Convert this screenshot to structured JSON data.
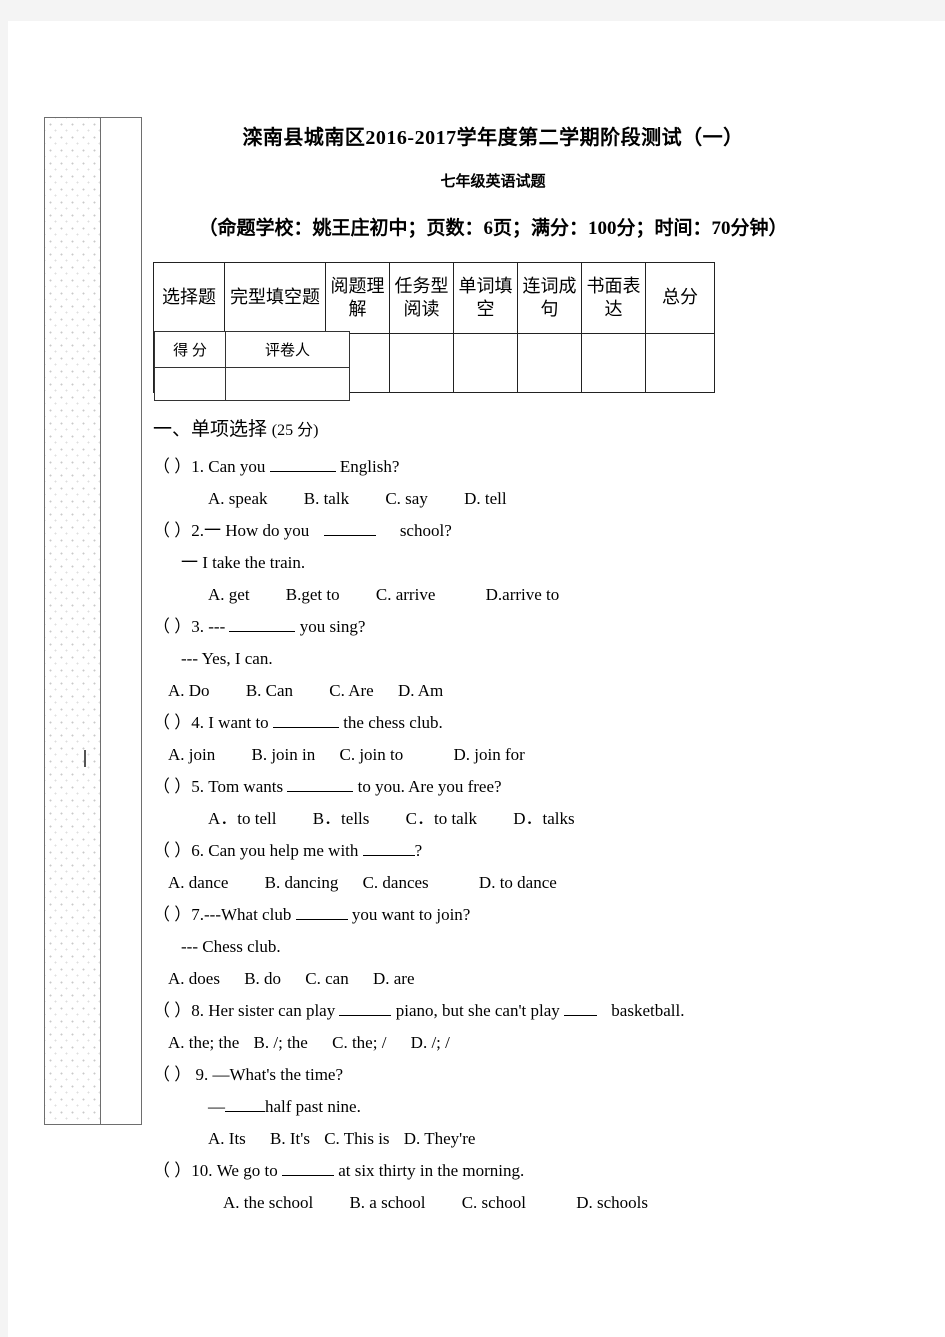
{
  "document": {
    "title_main": "滦南县城南区2016-2017学年度第二学期阶段测试（一）",
    "title_sub": "七年级英语试题",
    "title_info": "（命题学校：姚王庄初中；页数：6页；满分：100分；时间：70分钟）"
  },
  "score_table": {
    "headers": [
      "选择题",
      "完型填空题",
      "阅题理解",
      "任务型阅读",
      "单词填空",
      "连词成句",
      "书面表达",
      "总分"
    ],
    "grader_box": {
      "score_label": "得 分",
      "grader_label": "评卷人"
    }
  },
  "sections": [
    {
      "heading_cn": "一、单项选择",
      "heading_points": "(25 分)",
      "questions": [
        {
          "num": "（   ）1.",
          "stem_pre": "Can you",
          "stem_post": "English?",
          "options": [
            "A. speak",
            "B. talk",
            "C. say",
            "D. tell"
          ]
        },
        {
          "num": "（   ）2.",
          "stem_pre": "一 How do you",
          "stem_post": "school?",
          "answer_line": "一 I take the train.",
          "options": [
            "A. get",
            "B.get to",
            "C. arrive",
            "D.arrive to"
          ]
        },
        {
          "num": "（   ）3.",
          "stem_pre": "---",
          "stem_post": "you sing?",
          "answer_line": "--- Yes, I can.",
          "options": [
            "A. Do",
            "B. Can",
            "C. Are",
            "D. Am"
          ]
        },
        {
          "num": "（   ）4.",
          "stem_pre": "I want to",
          "stem_post": "the chess club.",
          "options": [
            "A. join",
            "B. join in",
            "C. join to",
            "D. join for"
          ]
        },
        {
          "num": "（   ）5.",
          "stem_pre": "Tom wants",
          "stem_post": "to you. Are you free?",
          "options": [
            "A．to tell",
            "B．tells",
            "C．to talk",
            "D．talks"
          ]
        },
        {
          "num": "（   ）6.",
          "stem_pre": "Can you help me with",
          "stem_post": "?",
          "options": [
            "A. dance",
            "B. dancing",
            "C. dances",
            "D. to dance"
          ]
        },
        {
          "num": "（   ）7.",
          "stem_pre": "---What club",
          "stem_post": "you want to join?",
          "answer_line": "--- Chess club.",
          "options": [
            "A. does",
            "B. do",
            "C. can",
            "D. are"
          ]
        },
        {
          "num": "（   ）8.",
          "stem_pre": "Her sister can play",
          "stem_mid": "piano, but she can't play",
          "stem_post": "basketball.",
          "options": [
            "A. the; the",
            "B. /; the",
            "C. the; /",
            "D. /; /"
          ]
        },
        {
          "num": "（    ） 9.",
          "stem_pre": "—What's the time?",
          "answer_line": "—",
          "answer_line_post": "half past nine.",
          "options": [
            "A. Its",
            "B. It's",
            "C. This is",
            "D. They're"
          ]
        },
        {
          "num": "（    ）10.",
          "stem_pre": "We go to",
          "stem_post": "at six thirty in the morning.",
          "options": [
            "A. the school",
            "B. a school",
            "C. school",
            "D. schools"
          ]
        }
      ]
    }
  ]
}
